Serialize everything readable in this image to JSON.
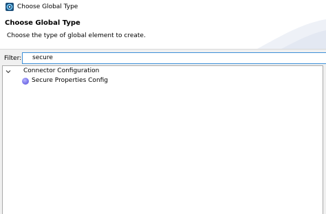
{
  "window": {
    "title": "Choose Global Type"
  },
  "header": {
    "title": "Choose Global Type",
    "description": "Choose the type of global element to create."
  },
  "filter": {
    "label": "Filter:",
    "value": "secure"
  },
  "tree": {
    "category": {
      "label": "Connector Configuration",
      "expanded": true
    },
    "items": [
      {
        "label": "Secure Properties Config",
        "icon": "config-dot-icon"
      }
    ]
  },
  "colors": {
    "focus_border": "#3b8ed8",
    "node_icon": "#7c77ea",
    "panel_bg": "#f0f0f0"
  }
}
